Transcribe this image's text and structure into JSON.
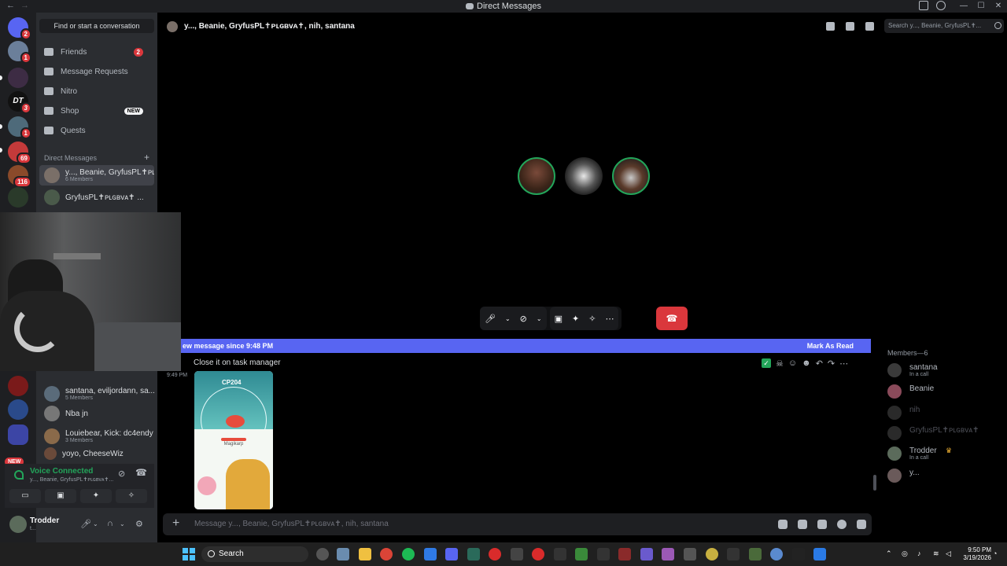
{
  "window": {
    "title": "Direct Messages"
  },
  "sidebar": {
    "find_button": "Find or start a conversation",
    "nav": [
      {
        "label": "Friends",
        "count": "2"
      },
      {
        "label": "Message Requests"
      },
      {
        "label": "Nitro"
      },
      {
        "label": "Shop",
        "tag": "NEW"
      },
      {
        "label": "Quests"
      }
    ],
    "dm_header": "Direct Messages",
    "dms": [
      {
        "name": "y..., Beanie, GryfusPL✝ᴘʟɢʙᴠᴀ✝...",
        "sub": "6 Members"
      },
      {
        "name": "GryfusPL✝ᴘʟɢʙᴠᴀ✝ ..."
      },
      {
        "name": "santana, eviljordann, sa...",
        "sub": "5 Members"
      },
      {
        "name": "Nba jn"
      },
      {
        "name": "Louiebear, Kick: dc4endy",
        "sub": "3 Members"
      },
      {
        "name": "yoyo, CheeseWiz"
      }
    ]
  },
  "servers": {
    "badges": [
      "2",
      "1",
      "3",
      "1",
      "69",
      "116"
    ],
    "new_tag": "NEW"
  },
  "voice": {
    "status": "Voice Connected",
    "channel": "y..., Beanie, GryfusPL✝ᴘʟɢʙᴠᴀ✝..."
  },
  "user": {
    "name": "Trodder",
    "status": "t..."
  },
  "header": {
    "title": "y..., Beanie, GryfusPL✝ᴘʟɢʙᴠᴀ✝, nih, santana",
    "search_placeholder": "Search y..., Beanie, GryfusPL✝..."
  },
  "new_messages": {
    "text": "ew message since 9:48 PM",
    "action": "Mark As Read"
  },
  "message": {
    "text": "Close it on task manager",
    "time": "9:49 PM",
    "image": {
      "cp": "CP204",
      "name": "Magikarp"
    }
  },
  "composer": {
    "placeholder": "Message y..., Beanie, GryfusPL✝ᴘʟɢʙᴠᴀ✝, nih, santana"
  },
  "members": {
    "header": "Members—6",
    "list": [
      {
        "name": "santana",
        "sub": "In a call",
        "dim": false
      },
      {
        "name": "Beanie",
        "sub": "",
        "dim": false
      },
      {
        "name": "nih",
        "sub": "",
        "dim": true
      },
      {
        "name": "GryfusPL✝ᴘʟɢʙᴠᴀ✝",
        "sub": "",
        "dim": true
      },
      {
        "name": "Trodder",
        "sub": "In a call",
        "dim": false
      },
      {
        "name": "y...",
        "sub": "",
        "dim": false
      }
    ]
  },
  "taskbar": {
    "search": "Search",
    "time": "9:50 PM",
    "date": "3/19/2026"
  },
  "colors": {
    "accent": "#5865f2",
    "danger": "#da373c",
    "online": "#23a55a"
  }
}
